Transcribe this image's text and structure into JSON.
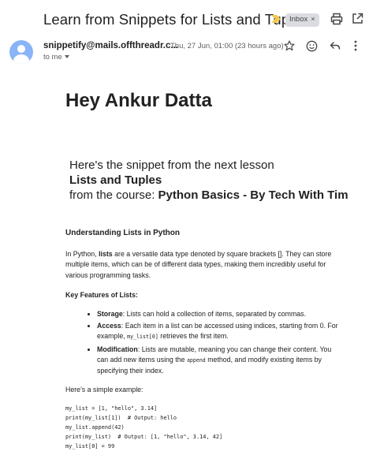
{
  "email": {
    "subject": "Learn from Snippets for Lists and Tuples",
    "label": "Inbox",
    "label_close": "×",
    "sender": "snippetify@mails.offthreadr.c...",
    "date": "Thu, 27 Jun, 01:00 (23 hours ago)",
    "recipient": "to me"
  },
  "body": {
    "greeting": "Hey Ankur Datta",
    "intro_line": "Here's the snippet from the next lesson",
    "lesson": "Lists and Tuples",
    "course_prefix": "from the course: ",
    "course": "Python Basics - By Tech With Tim",
    "section_title": "Understanding Lists in Python",
    "para_before_bold": "In Python, ",
    "para_bold": "lists",
    "para_after_bold": " are a versatile data type denoted by square brackets []. They can store multiple items, which can be of different data types, making them incredibly useful for various programming tasks.",
    "features_title": "Key Features of Lists:",
    "features": [
      {
        "term": "Storage",
        "text": ": Lists can hold a collection of items, separated by commas."
      },
      {
        "term": "Access",
        "text": ": Each item in a list can be accessed using indices, starting from 0. For example, ",
        "code": "my_list[0]",
        "text_after": " retrieves the first item."
      },
      {
        "term": "Modification",
        "text": ": Lists are mutable, meaning you can change their content. You can add new items using the ",
        "code": "append",
        "text_after": " method, and modify existing items by specifying their index."
      }
    ],
    "example_intro": "Here's a simple example:",
    "code_lines": [
      "my_list = [1, \"hello\", 3.14]",
      "print(my_list[1])  # Output: hello",
      "my_list.append(42)",
      "print(my_list)  # Output: [1, \"hello\", 3.14, 42]",
      "my_list[0] = 99"
    ]
  },
  "icons": {
    "important": "important-marker-icon",
    "print": "print-icon",
    "popout": "open-in-new-window-icon",
    "star": "star-icon",
    "emoji": "emoji-reaction-icon",
    "reply": "reply-icon",
    "more": "more-vert-icon"
  },
  "colors": {
    "important_marker": "#f2c94c",
    "avatar_bg": "#8ab4f8",
    "label_chip_bg": "#dadce0"
  }
}
